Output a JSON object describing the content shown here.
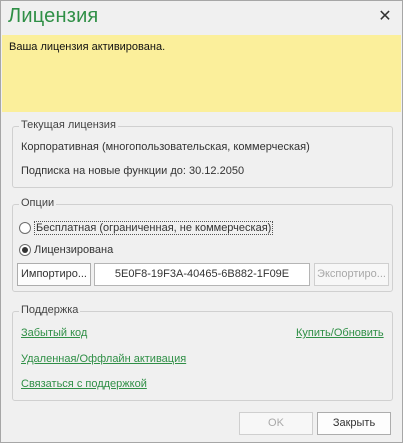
{
  "window": {
    "title": "Лицензия",
    "close_glyph": "✕"
  },
  "banner": {
    "text": "Ваша лицензия активирована."
  },
  "current_license": {
    "legend": "Текущая лицензия",
    "type_text": "Корпоративная (многопользовательская, коммерческая)",
    "subscription_text": "Подписка на новые функции до: 30.12.2050"
  },
  "options": {
    "legend": "Опции",
    "radio_free_label": "Бесплатная (ограниченная, не коммерческая)",
    "radio_licensed_label": "Лицензирована",
    "selected": "licensed",
    "import_label": "Импортиро...",
    "license_key": "5E0F8-19F3A-40465-6B882-1F09E",
    "export_label": "Экспортиро..."
  },
  "support": {
    "legend": "Поддержка",
    "forgot_key_link": "Забытый код",
    "buy_update_link": "Купить/Обновить",
    "offline_activation_link": "Удаленная/Оффлайн активация",
    "contact_support_link": "Связаться с поддержкой"
  },
  "footer": {
    "ok_label": "OK",
    "close_label": "Закрыть"
  },
  "colors": {
    "accent": "#2f8f46",
    "banner": "#fbef9b"
  }
}
